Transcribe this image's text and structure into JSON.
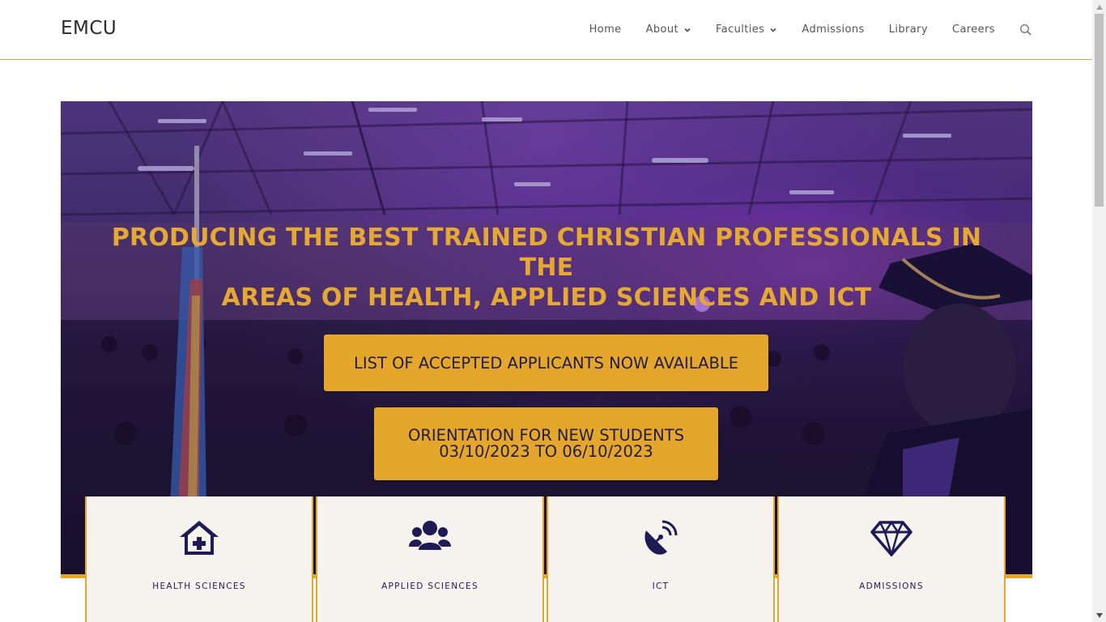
{
  "site": {
    "logo": "EMCU"
  },
  "nav": {
    "items": [
      {
        "label": "Home",
        "dropdown": false
      },
      {
        "label": "About",
        "dropdown": true
      },
      {
        "label": "Faculties",
        "dropdown": true
      },
      {
        "label": "Admissions",
        "dropdown": false
      },
      {
        "label": "Library",
        "dropdown": false
      },
      {
        "label": "Careers",
        "dropdown": false
      }
    ],
    "search_icon": "search-icon"
  },
  "hero": {
    "title_line1": "PRODUCING THE BEST TRAINED CHRISTIAN PROFESSIONALS IN THE",
    "title_line2": "AREAS OF HEALTH, APPLIED SCIENCES AND ICT",
    "cta_primary": "LIST OF ACCEPTED APPLICANTS NOW AVAILABLE",
    "cta_secondary_line1": "ORIENTATION FOR NEW STUDENTS",
    "cta_secondary_line2": "03/10/2023 TO 06/10/2023"
  },
  "cards": [
    {
      "label": "HEALTH SCIENCES",
      "icon": "clinic-icon"
    },
    {
      "label": "APPLIED SCIENCES",
      "icon": "users-icon"
    },
    {
      "label": "ICT",
      "icon": "satellite-dish-icon"
    },
    {
      "label": "ADMISSIONS",
      "icon": "gem-icon"
    }
  ],
  "colors": {
    "accent": "#e4a72c",
    "navy": "#1d1a55",
    "card_bg": "#f6f3ee"
  }
}
